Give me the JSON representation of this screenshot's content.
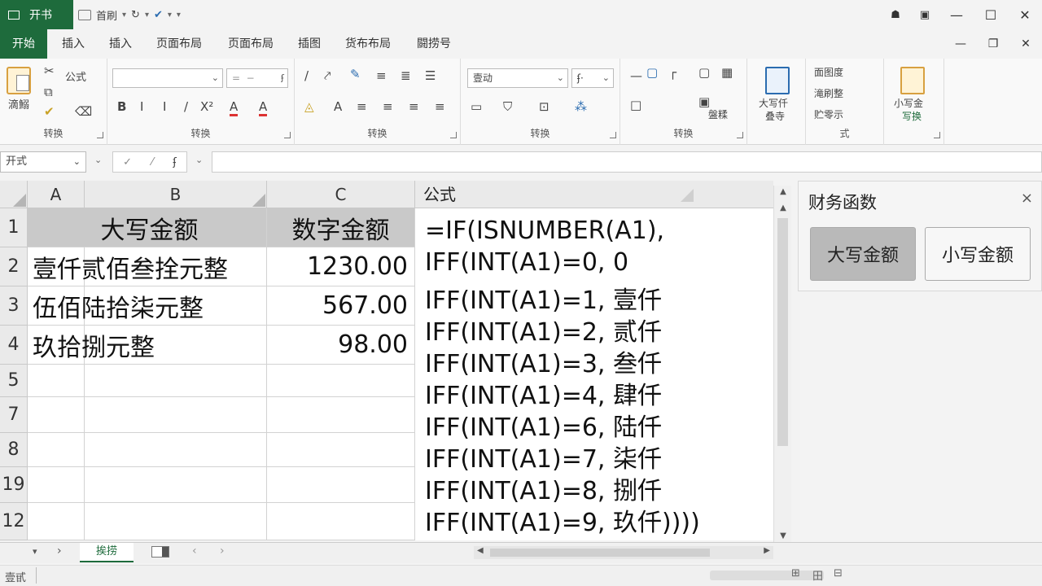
{
  "titlebar": {
    "app_label": "开书",
    "qat_label": "首刷",
    "accent": "#1e6b3c"
  },
  "ribbon_tabs": [
    "开始",
    "插入",
    "插入",
    "页面布局",
    "页面布局",
    "插图",
    "货布布局",
    "闘捞号"
  ],
  "ribbon": {
    "paste_label": "滴鰯",
    "formula_label": "公式",
    "font_combo_value": "",
    "style_combo_value": "壹动",
    "big_btn_label": "大写仟",
    "big_btn_sub": "叠寺",
    "side_btn_label": "小写金",
    "side_btn_sub": "写换",
    "list_items": [
      "面图度",
      "滝刷整",
      "贮零示"
    ],
    "list2_item": "盤糅",
    "group_labels": [
      "转换",
      "转换",
      "转换",
      "转换",
      "转换",
      "式"
    ]
  },
  "formula_bar": {
    "name_box": "开式"
  },
  "grid": {
    "columns": [
      "A",
      "B",
      "C"
    ],
    "rows": [
      {
        "row": "1",
        "b": "大写金额",
        "c": "数字金额",
        "header": true
      },
      {
        "row": "2",
        "b": "壹仟贰佰叁拴元整",
        "c": "1230.00"
      },
      {
        "row": "3",
        "b": "伍佰陆拾柒元整",
        "c": "567.00"
      },
      {
        "row": "4",
        "b": "玖拾捌元整",
        "c": "98.00"
      },
      {
        "row": "5",
        "b": "",
        "c": ""
      },
      {
        "row": "7",
        "b": "",
        "c": ""
      },
      {
        "row": "8",
        "b": "",
        "c": ""
      },
      {
        "row": "19",
        "b": "",
        "c": ""
      },
      {
        "row": "12",
        "b": "",
        "c": ""
      }
    ]
  },
  "formula_pane": {
    "header": "公式",
    "lines": [
      "=IF(ISNUMBER(A1),",
      "IFF(INT(A1)=0, 0",
      "IFF(INT(A1)=1, 壹仟",
      "IFF(INT(A1)=2, 贰仟",
      "IFF(INT(A1)=3, 叁仟",
      "IFF(INT(A1)=4, 肆仟",
      "IFF(INT(A1)=6, 陆仟",
      "IFF(INT(A1)=7, 柒仟",
      "IFF(INT(A1)=8, 捌仟",
      "IFF(INT(A1)=9, 玖仟))))"
    ]
  },
  "panel": {
    "title": "财务函数",
    "close": "×",
    "buttons": [
      {
        "label": "大写金额",
        "active": true
      },
      {
        "label": "小写金额",
        "active": false
      }
    ]
  },
  "sheets": {
    "active_tab": "挨捞"
  },
  "status": {
    "left_text": "壹甙"
  }
}
